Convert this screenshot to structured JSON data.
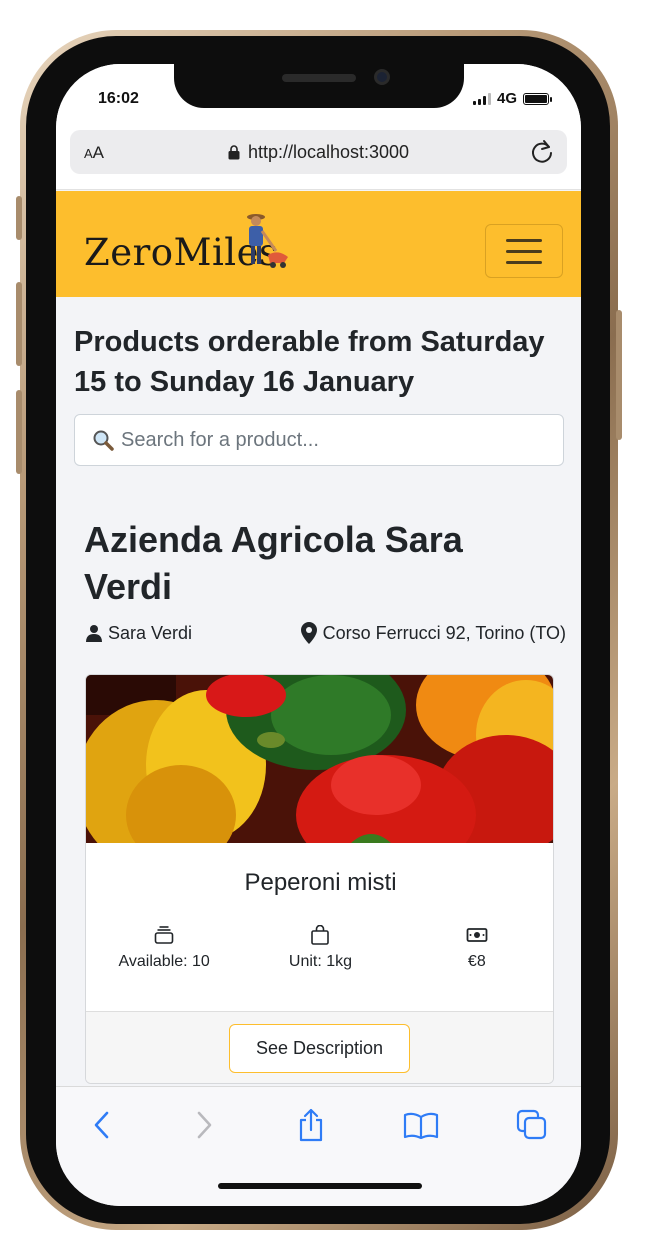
{
  "status_bar": {
    "time": "16:02",
    "network": "4G"
  },
  "browser": {
    "aa_label": "AA",
    "url": "http://localhost:3000"
  },
  "navbar": {
    "brand": "ZeroMiles"
  },
  "page": {
    "heading": "Products orderable from Saturday 15 to Sunday 16 January",
    "search_placeholder": "Search for a product..."
  },
  "farm": {
    "name": "Azienda Agricola Sara Verdi",
    "owner": "Sara Verdi",
    "address": "Corso Ferrucci 92, Torino (TO)"
  },
  "product": {
    "name": "Peperoni misti",
    "available": "Available: 10",
    "unit": "Unit: 1kg",
    "price": "€8",
    "button_label": "See Description"
  },
  "colors": {
    "brand_yellow": "#fdbe2d",
    "ios_blue": "#2f7cf6",
    "page_bg": "#f3f4f7"
  },
  "icons": [
    "lock-icon",
    "reload-icon",
    "farmer-logo-icon",
    "menu-icon",
    "search-icon",
    "person-icon",
    "location-pin-icon",
    "stack-icon",
    "bag-icon",
    "cash-icon",
    "back-icon",
    "forward-icon",
    "share-icon",
    "bookmarks-icon",
    "tabs-icon"
  ]
}
